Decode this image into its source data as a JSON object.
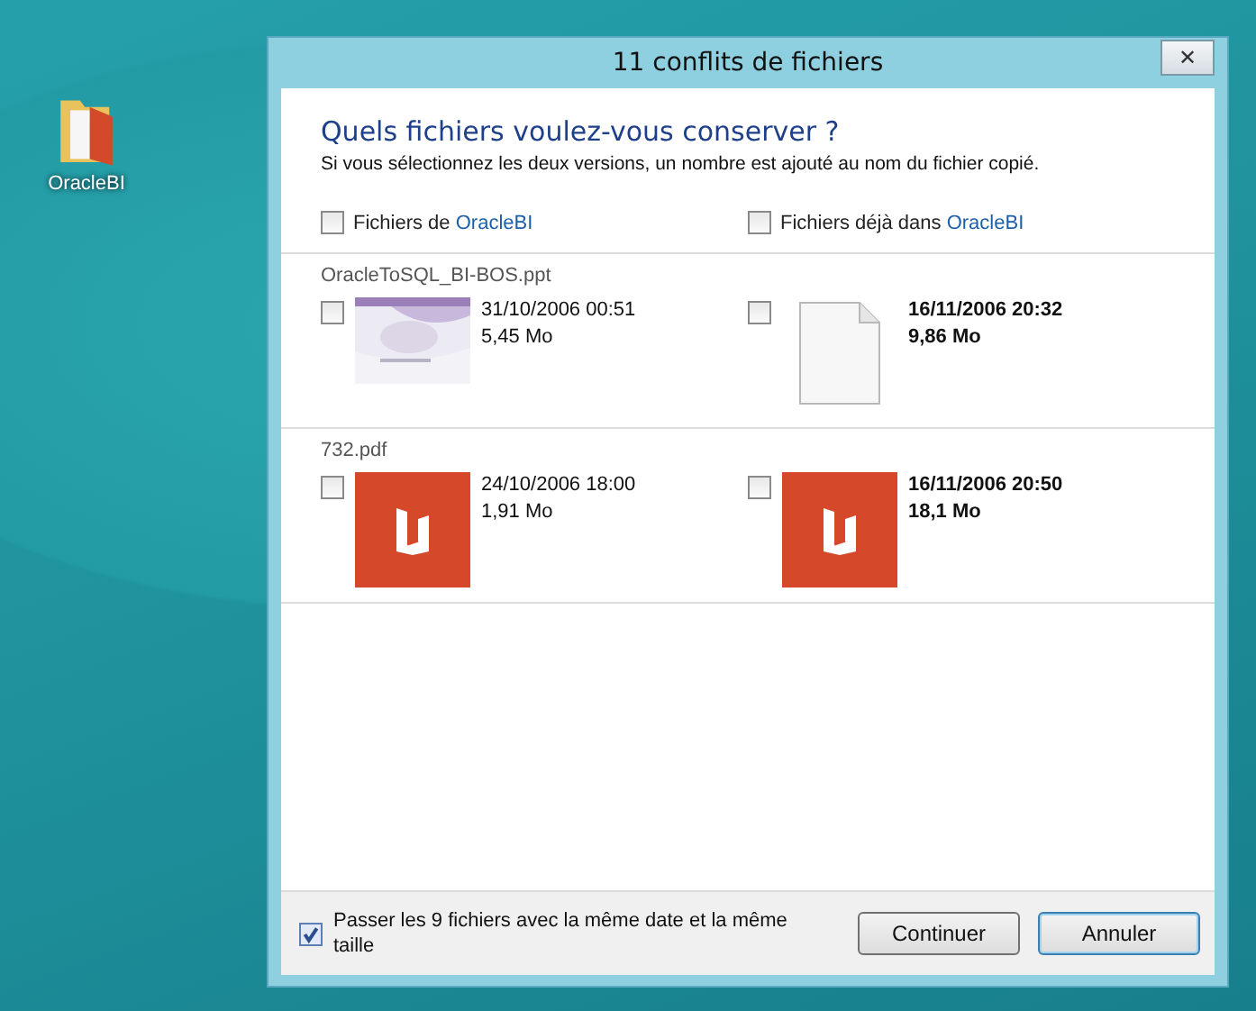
{
  "desktop_icon": {
    "label": "OracleBI"
  },
  "window": {
    "title": "11 conflits de fichiers",
    "close": "✕"
  },
  "heading": "Quels fichiers voulez-vous conserver ?",
  "description": "Si vous sélectionnez les deux versions, un nombre est ajouté au nom du fichier copié.",
  "columns": [
    {
      "prefix": "Fichiers de",
      "link": "OracleBI",
      "checked": false
    },
    {
      "prefix": "Fichiers déjà dans",
      "link": "OracleBI",
      "checked": false
    }
  ],
  "files": [
    {
      "name": "OracleToSQL_BI-BOS.ppt",
      "versions": [
        {
          "checked": false,
          "kind": "picture",
          "date": "31/10/2006 00:51",
          "size": "5,45 Mo",
          "bold": false
        },
        {
          "checked": false,
          "kind": "blank",
          "date": "16/11/2006 20:32",
          "size": "9,86 Mo",
          "bold": true
        }
      ]
    },
    {
      "name": "732.pdf",
      "versions": [
        {
          "checked": false,
          "kind": "pdf",
          "date": "24/10/2006 18:00",
          "size": "1,91 Mo",
          "bold": false
        },
        {
          "checked": false,
          "kind": "pdf",
          "date": "16/11/2006 20:50",
          "size": "18,1 Mo",
          "bold": true
        }
      ]
    }
  ],
  "skip_option": {
    "label": "Passer les 9 fichiers avec la même date et la même taille",
    "checked": true
  },
  "buttons": [
    {
      "label": "Continuer",
      "default": false
    },
    {
      "label": "Annuler",
      "default": true
    }
  ]
}
